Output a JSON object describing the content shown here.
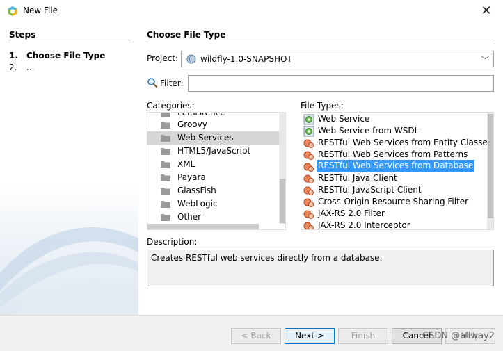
{
  "window": {
    "title": "New File"
  },
  "steps": {
    "heading": "Steps",
    "items": [
      {
        "num": "1.",
        "label": "Choose File Type"
      },
      {
        "num": "2.",
        "label": "..."
      }
    ]
  },
  "panel": {
    "title": "Choose File Type",
    "project_label": "Project:",
    "project_value": "wildfly-1.0-SNAPSHOT",
    "filter_label": "Filter:",
    "filter_value": "",
    "categories_label": "Categories:",
    "file_types_label": "File Types:",
    "description_label": "Description:",
    "description": "Creates RESTful web services directly from a database."
  },
  "categories": [
    {
      "label": "Persistence"
    },
    {
      "label": "Groovy"
    },
    {
      "label": "Web Services"
    },
    {
      "label": "HTML5/JavaScript"
    },
    {
      "label": "XML"
    },
    {
      "label": "Payara"
    },
    {
      "label": "GlassFish"
    },
    {
      "label": "WebLogic"
    },
    {
      "label": "Other"
    }
  ],
  "selected_category": "Web Services",
  "file_types": [
    {
      "label": "Web Service",
      "icon": "web-service-icon"
    },
    {
      "label": "Web Service from WSDL",
      "icon": "web-service-icon"
    },
    {
      "label": "RESTful Web Services from Entity Classes",
      "icon": "rest-icon"
    },
    {
      "label": "RESTful Web Services from Patterns",
      "icon": "rest-icon"
    },
    {
      "label": "RESTful Web Services from Database",
      "icon": "rest-icon"
    },
    {
      "label": "RESTful Java Client",
      "icon": "rest-icon"
    },
    {
      "label": "RESTful JavaScript Client",
      "icon": "rest-icon"
    },
    {
      "label": "Cross-Origin Resource Sharing Filter",
      "icon": "rest-icon"
    },
    {
      "label": "JAX-RS 2.0 Filter",
      "icon": "rest-icon"
    },
    {
      "label": "JAX-RS 2.0 Interceptor",
      "icon": "rest-icon"
    }
  ],
  "selected_file_type": "RESTful Web Services from Database",
  "buttons": {
    "back": "< Back",
    "next": "Next >",
    "finish": "Finish",
    "cancel": "Cancel",
    "help": "Help"
  },
  "watermark": "CSDN @allway2",
  "colors": {
    "selection_blue": "#3399ff",
    "selection_gray": "#d6d6d6"
  }
}
